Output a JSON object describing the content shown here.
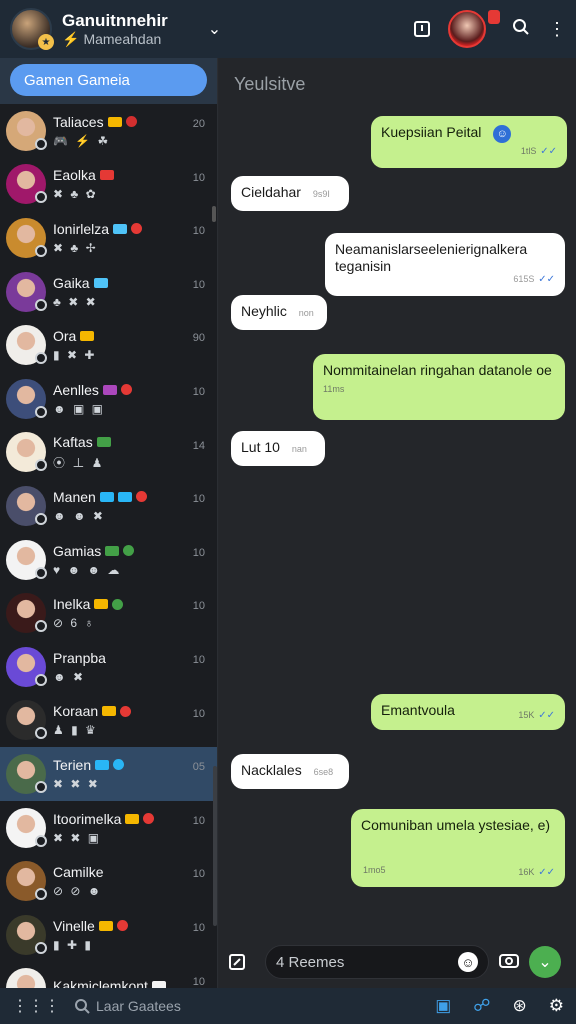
{
  "header": {
    "title": "Ganuitnnehir",
    "subtitle": "Mameahdan",
    "icons": [
      "chevron-down-icon",
      "tablet-icon",
      "profile-avatar",
      "search-icon",
      "more-vert-icon"
    ]
  },
  "sidebar": {
    "search_placeholder": "Gamen Gameia",
    "contacts": [
      {
        "name": "Taliaces",
        "icons": "🎮 ⚡ ☘",
        "time": "20",
        "colors": [
          "#f5b700",
          "#d32f2f"
        ],
        "avatar": "#d5a878"
      },
      {
        "name": "Eaolka",
        "icons": "✖ ♣ ✿",
        "time": "10",
        "colors": [
          "#e53935"
        ],
        "avatar": "#a0186a"
      },
      {
        "name": "Ionirlelza",
        "icons": "✖ ♣ ✢",
        "time": "10",
        "colors": [
          "#4fc3f7",
          "#e53935"
        ],
        "avatar": "#c98b2e"
      },
      {
        "name": "Gaika",
        "icons": "♣ ✖ ✖",
        "time": "10",
        "colors": [
          "#4fc3f7"
        ],
        "avatar": "#7a3a9a"
      },
      {
        "name": "Ora",
        "icons": "▮ ✖ ✚",
        "time": "90",
        "colors": [
          "#f5b700"
        ],
        "avatar": "#f0eeea"
      },
      {
        "name": "Aenlles",
        "icons": "☻ ▣ ▣",
        "time": "10",
        "colors": [
          "#ab47bc",
          "#e53935"
        ],
        "avatar": "#3d4e7a"
      },
      {
        "name": "Kaftas",
        "icons": "⦿ ⊥ ♟",
        "time": "14",
        "colors": [
          "#43a047"
        ],
        "avatar": "#f3ead9"
      },
      {
        "name": "Manen",
        "icons": "☻ ☻ ✖",
        "time": "10",
        "colors": [
          "#29b6f6",
          "#29b6f6",
          "#e53935"
        ],
        "avatar": "#4a4e6a"
      },
      {
        "name": "Gamias",
        "icons": "♥ ☻ ☻ ☁",
        "time": "10",
        "colors": [
          "#43a047",
          "#43a047"
        ],
        "avatar": "#f3f3f3"
      },
      {
        "name": "Inelka",
        "icons": "⊘ 6 ♁",
        "time": "10",
        "colors": [
          "#f5b700",
          "#43a047"
        ],
        "avatar": "#3a1a1a"
      },
      {
        "name": "Pranpba",
        "icons": "☻ ✖",
        "time": "10",
        "colors": [],
        "avatar": "#6a4ad6"
      },
      {
        "name": "Koraan",
        "icons": "♟ ▮ ♛",
        "time": "10",
        "colors": [
          "#f5b700",
          "#e53935"
        ],
        "avatar": "#2b2b2b"
      },
      {
        "name": "Terien",
        "icons": "✖ ✖ ✖",
        "time": "05",
        "colors": [
          "#29b6f6",
          "#29b6f6"
        ],
        "avatar": "#4a6a4a",
        "active": true
      },
      {
        "name": "Itoorimelka",
        "icons": "✖ ✖ ▣",
        "time": "10",
        "colors": [
          "#f5b700",
          "#e53935"
        ],
        "avatar": "#f4f4f4"
      },
      {
        "name": "Camilke",
        "icons": "⊘ ⊘ ☻",
        "time": "10",
        "colors": [],
        "avatar": "#8a5a2a"
      },
      {
        "name": "Vinelle",
        "icons": "▮ ✚ ▮",
        "time": "10",
        "colors": [
          "#f5b700",
          "#e53935"
        ],
        "avatar": "#3a3a2a"
      },
      {
        "name": "Kakmiclemkont",
        "icons": "",
        "time": "10",
        "colors": [
          "#f3f3f3"
        ],
        "avatar": "#f0eeea"
      }
    ]
  },
  "chat": {
    "title": "Yeulsitve",
    "messages": [
      {
        "dir": "out",
        "text": "Kuepsiian Peital",
        "time": "1tlS"
      },
      {
        "dir": "in",
        "text": "Cieldahar",
        "time": "9s9I"
      },
      {
        "dir": "in",
        "text": "Neamanislarseelenierignalkera teganisin",
        "time": "615S"
      },
      {
        "dir": "in",
        "text": "Neyhlic",
        "time": "non"
      },
      {
        "dir": "out",
        "text": "Nommitainelan ringahan datanole oe",
        "time": "11ms"
      },
      {
        "dir": "in",
        "text": "Lut 10",
        "time": "nan"
      },
      {
        "dir": "out",
        "text": "Emantvoula",
        "time": "15K"
      },
      {
        "dir": "in",
        "text": "Nacklales",
        "time": "6se8"
      },
      {
        "dir": "out",
        "text": "Comuniban umela ystesiae, e)",
        "time": "1mo5",
        "time2": "16K"
      }
    ]
  },
  "composer": {
    "input_value": "4 Reemes"
  },
  "bottombar": {
    "search_placeholder": "Laar Gaatees"
  }
}
